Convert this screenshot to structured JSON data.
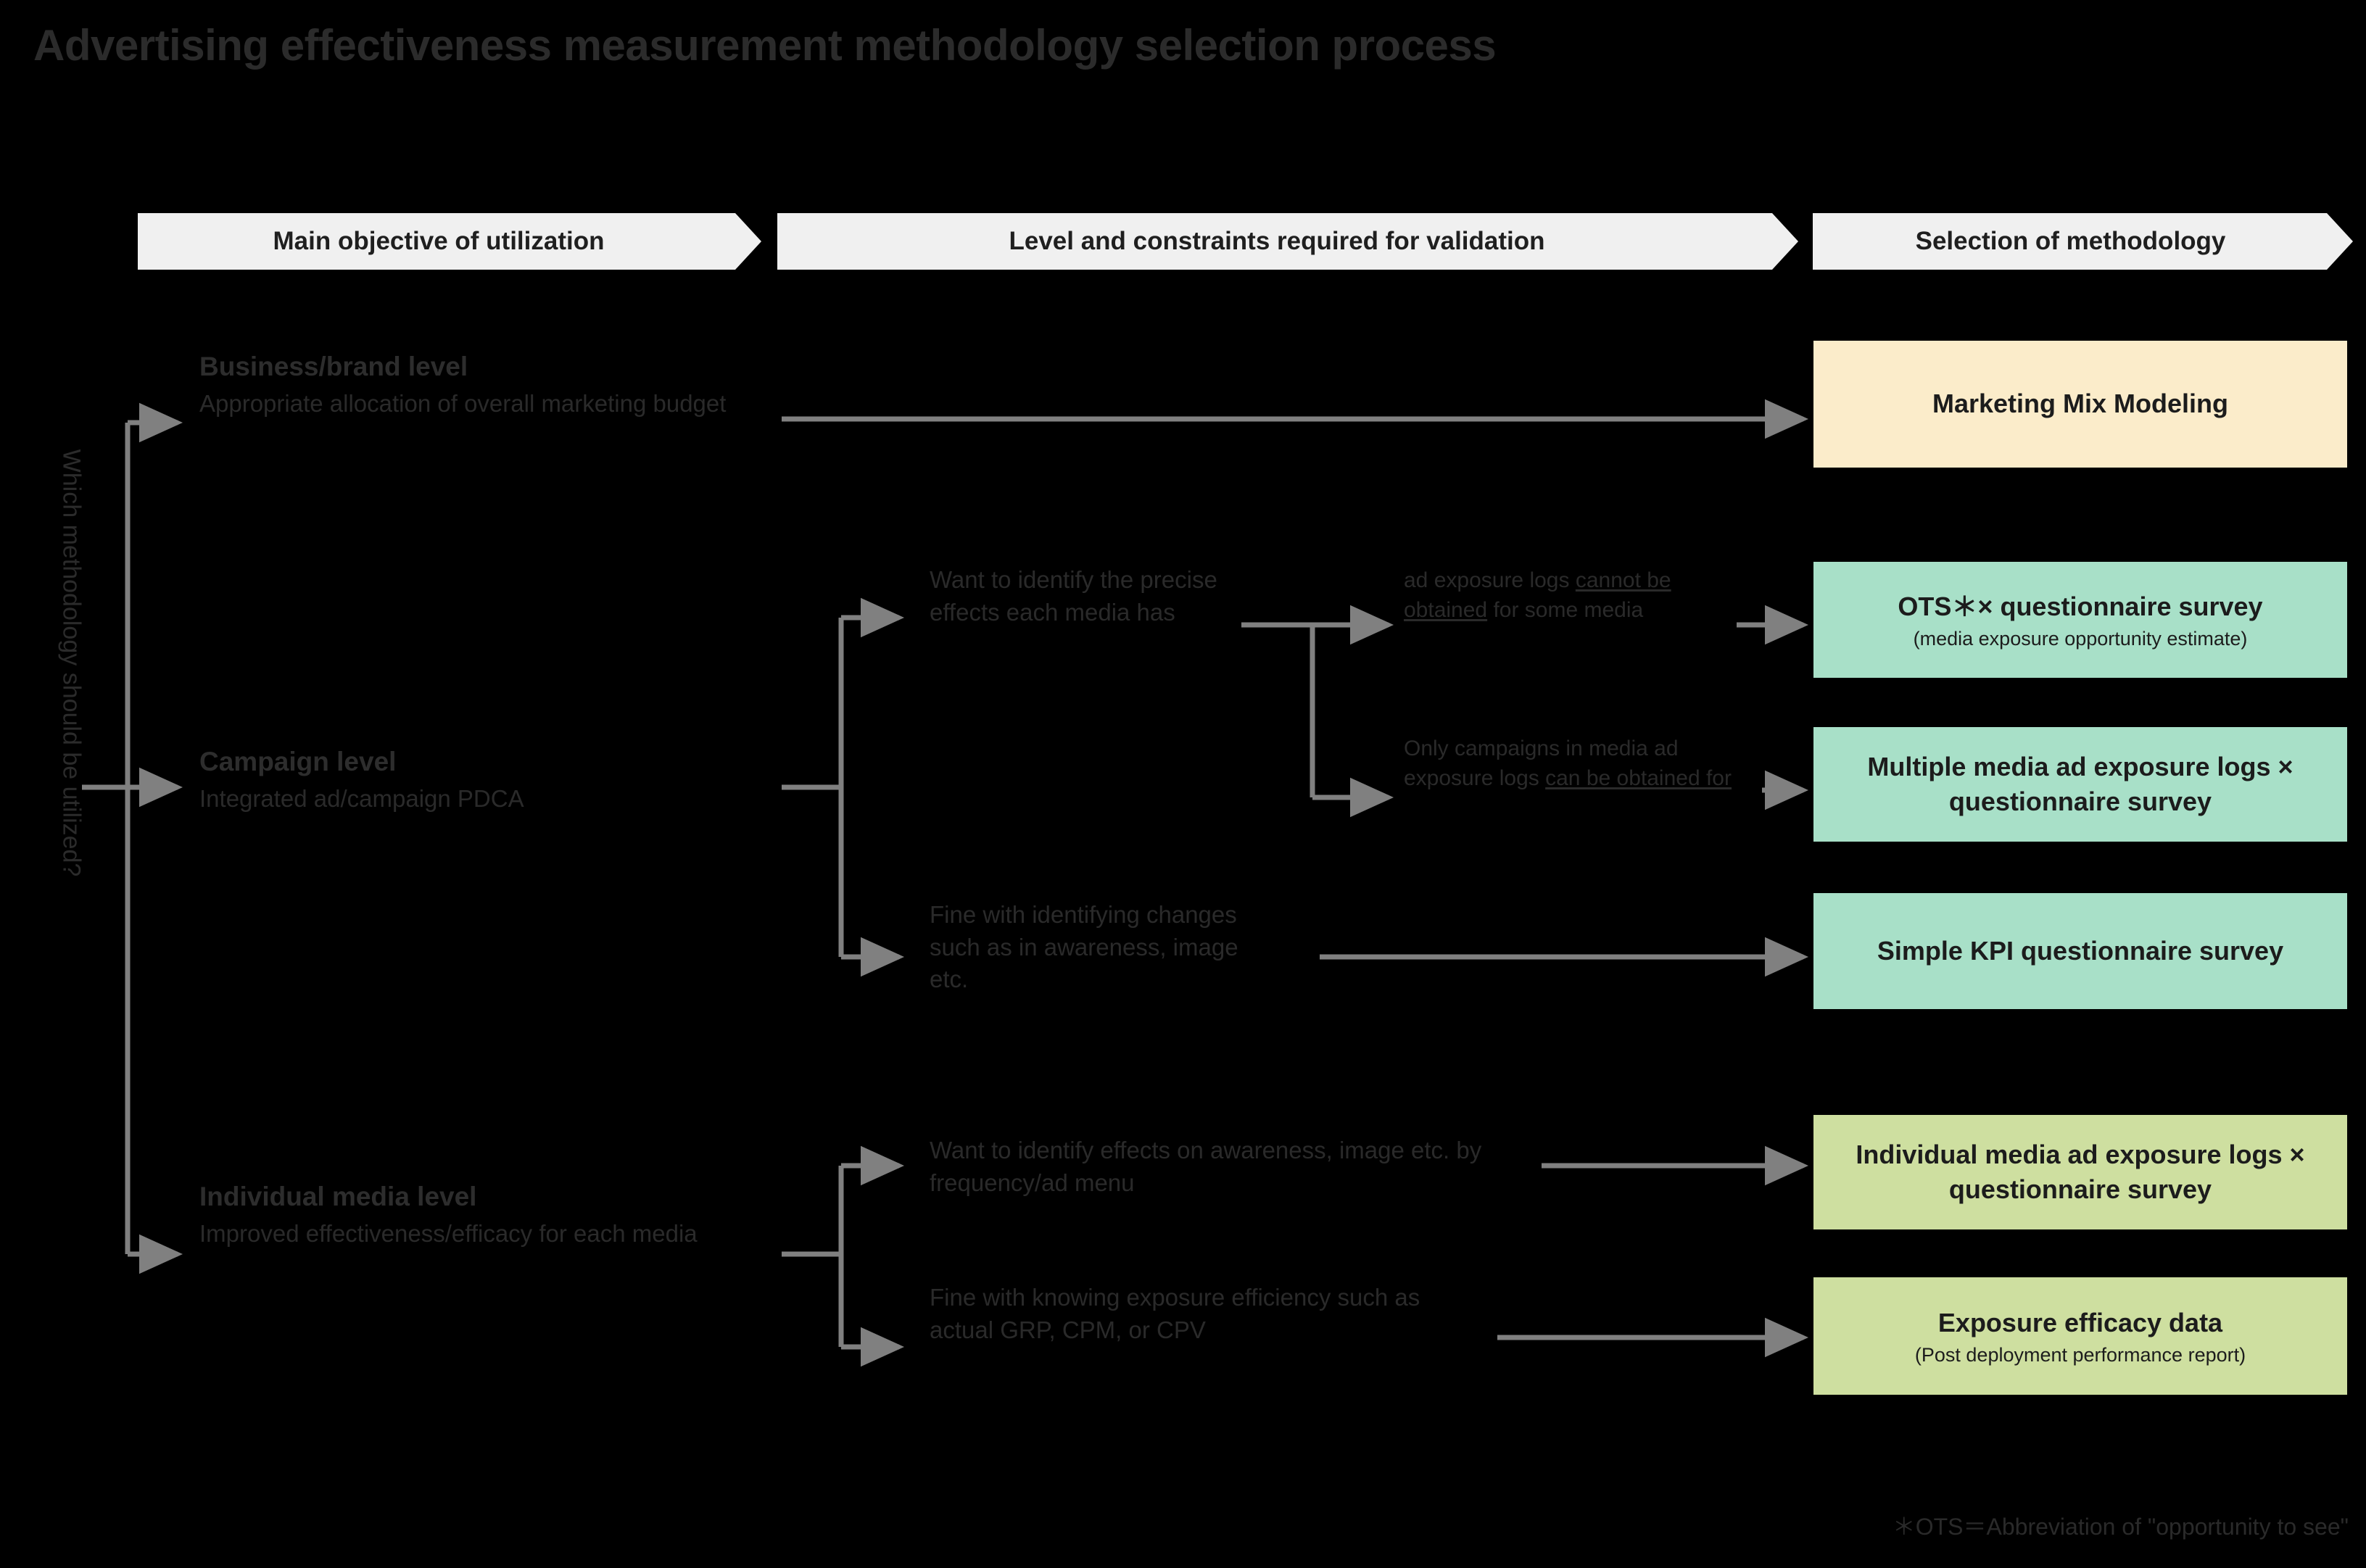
{
  "page": {
    "title": "Advertising effectiveness measurement methodology selection process",
    "vertical_question": "Which methodology should be utilized?",
    "footnote": "＊OTS＝Abbreviation of \"opportunity to see\"",
    "background_color": "#000000",
    "connector_color": "#808080"
  },
  "banners": [
    {
      "id": "objective",
      "label": "Main objective of utilization"
    },
    {
      "id": "constraints",
      "label": "Level and constraints required for validation"
    },
    {
      "id": "selection",
      "label": "Selection of methodology"
    }
  ],
  "levels": [
    {
      "id": "business",
      "title": "Business/brand level",
      "desc": "Appropriate allocation of overall marketing budget"
    },
    {
      "id": "campaign",
      "title": "Campaign level",
      "desc": "Integrated ad/campaign PDCA"
    },
    {
      "id": "individual",
      "title": "Individual media level",
      "desc": "Improved effectiveness/efficacy for each media"
    }
  ],
  "conditions": {
    "precise": "Want to identify the precise effects each media has",
    "awareness": "Fine with identifying changes such as in awareness, image etc.",
    "frequency": "Want to identify effects on awareness, image etc. by frequency/ad menu",
    "efficiency": "Fine with knowing exposure efficiency such as actual GRP, CPM, or CPV"
  },
  "constraints": {
    "cannot": {
      "pre": "ad exposure logs ",
      "underlined": "cannot be obtained",
      "post": " for some media"
    },
    "can": {
      "pre": "Only campaigns in media ad exposure logs ",
      "underlined": "can be obtained for",
      "post": ""
    }
  },
  "results": [
    {
      "id": "mmm",
      "main": "Marketing Mix Modeling",
      "sub": "",
      "color": "#fbecca"
    },
    {
      "id": "ots",
      "main": "OTS＊× questionnaire survey",
      "sub": "(media exposure opportunity estimate)",
      "color": "#a8e0c8"
    },
    {
      "id": "multiple",
      "main": "Multiple media ad exposure logs × questionnaire survey",
      "sub": "",
      "color": "#a8e0c8"
    },
    {
      "id": "kpi",
      "main": "Simple KPI questionnaire survey",
      "sub": "",
      "color": "#a8e0c8"
    },
    {
      "id": "individual",
      "main": "Individual media ad exposure logs × questionnaire survey",
      "sub": "",
      "color": "#cedfa0"
    },
    {
      "id": "exposure",
      "main": "Exposure efficacy data",
      "sub": "(Post deployment performance report)",
      "color": "#cedfa0"
    }
  ]
}
